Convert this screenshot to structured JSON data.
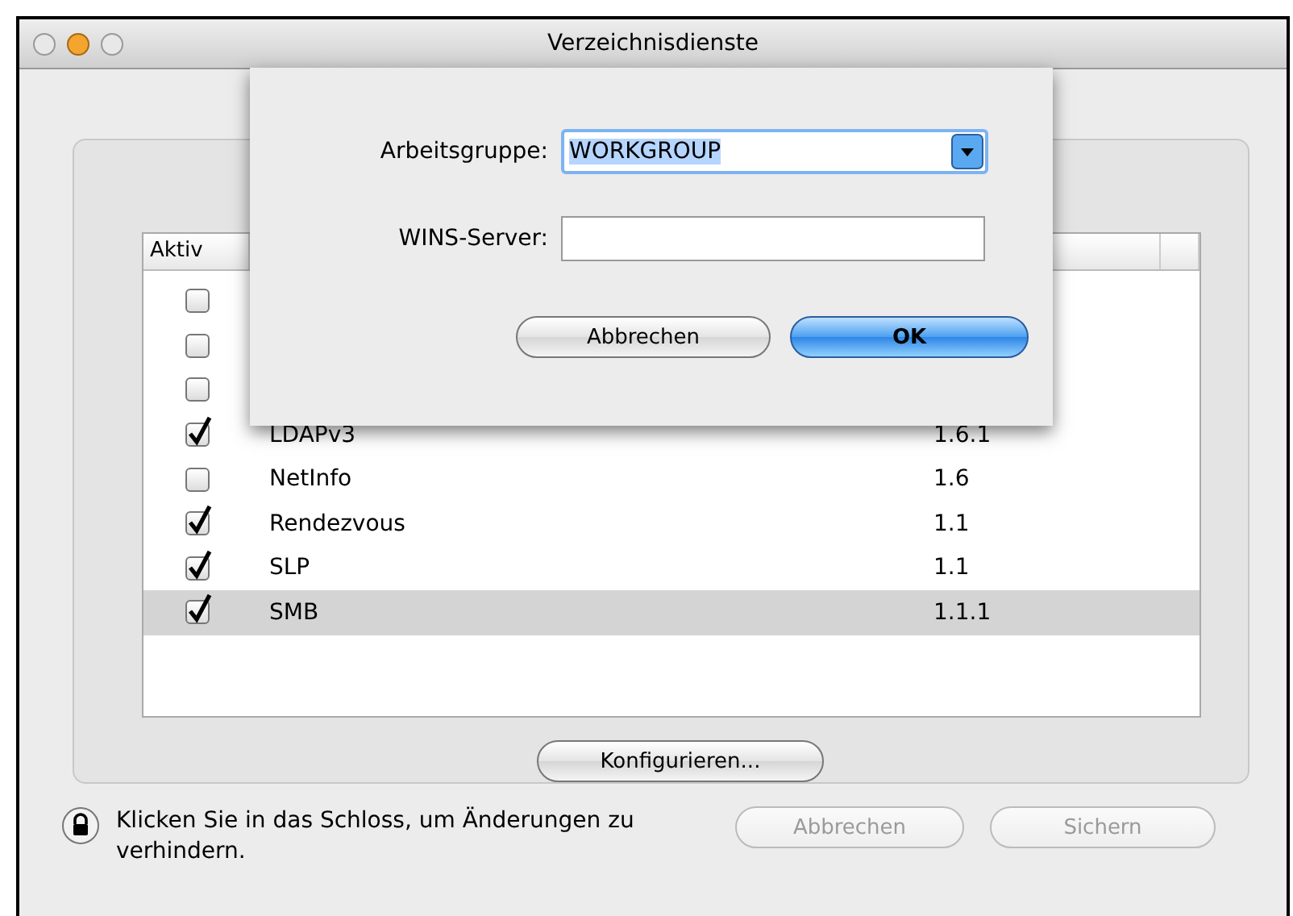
{
  "window": {
    "title": "Verzeichnisdienste"
  },
  "table": {
    "columns": [
      "Aktiv"
    ],
    "rows": [
      {
        "checked": false,
        "selected": false
      },
      {
        "checked": false,
        "selected": false
      },
      {
        "checked": false,
        "selected": false
      },
      {
        "checked": true,
        "name": "LDAPv3",
        "version": "1.6.1",
        "selected": false
      },
      {
        "checked": false,
        "name": "NetInfo",
        "version": "1.6",
        "selected": false
      },
      {
        "checked": true,
        "name": "Rendezvous",
        "version": "1.1",
        "selected": false
      },
      {
        "checked": true,
        "name": "SLP",
        "version": "1.1",
        "selected": false
      },
      {
        "checked": true,
        "name": "SMB",
        "version": "1.1.1",
        "selected": true
      }
    ]
  },
  "configure_button": {
    "label": "Konfigurieren..."
  },
  "lock_text": "Klicken Sie in das Schloss, um Änderungen zu verhindern.",
  "buttons": [
    {
      "label": "Abbrechen",
      "disabled": true
    },
    {
      "label": "Sichern",
      "disabled": true
    }
  ],
  "sheet": {
    "fields": [
      {
        "kind": "combo",
        "label": "Arbeitsgruppe:",
        "value": "WORKGROUP"
      },
      {
        "kind": "text",
        "label": "WINS-Server:"
      }
    ],
    "buttons": [
      {
        "label": "Abbrechen",
        "default": false
      },
      {
        "label": "OK",
        "default": true
      }
    ]
  }
}
